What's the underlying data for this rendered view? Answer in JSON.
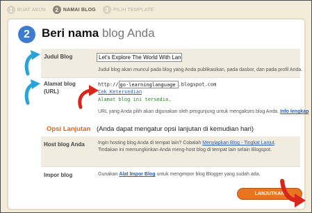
{
  "steps": [
    {
      "num": "1",
      "label": "BUAT AKUN"
    },
    {
      "num": "2",
      "label": "NAMAI BLOG"
    },
    {
      "num": "3",
      "label": "PILIH TEMPLATE"
    }
  ],
  "header": {
    "step_number": "2",
    "title_bold": "Beri nama",
    "title_light": "blog Anda"
  },
  "blog_title": {
    "label": "Judul Blog",
    "value": "Let's Explore The World With Lan",
    "help": "Judul blog akan muncul pada blog yang Anda publikasikan, pada dasbor, dan pada profil Anda."
  },
  "blog_address": {
    "label_line1": "Alamat blog",
    "label_line2": "(URL)",
    "prefix": "http://",
    "value": "go-learninglanguage",
    "suffix": ".blogspot.com",
    "check_link": "Cek Ketersedian",
    "status": "Alamat blog ini tersedia.",
    "help": "URL yang Anda pilih akan digunakan oleh pengunjung untuk mengakses blog Anda.",
    "info_link": "Info lengkap"
  },
  "advanced": {
    "title": "Opsi Lanjutan",
    "note": "(Anda dapat mengatur opsi lanjutan di kemudian hari)"
  },
  "host": {
    "label": "Host blog Anda",
    "text_before": "Ingin hosting blog Anda di tempat lain? Cobalah",
    "link": "Menyiapkan Blog - Tingkat Lanjut",
    "text_after": ". Tindakan ini memungkinkan Anda meng-host blog di tempat lain selain Blogspot."
  },
  "import": {
    "label": "Impor blog",
    "text_before": "Gunakan",
    "link": "Alat Impor Blog",
    "text_after": "untuk mengimpor blog Blogger yang sudah ada."
  },
  "continue_button": "LANJUTKAN",
  "colors": {
    "accent_blue": "#3d7bd0",
    "orange": "#e0651a",
    "arrow_red": "#d9261c",
    "cyan_arrow": "#2aa3d6"
  }
}
